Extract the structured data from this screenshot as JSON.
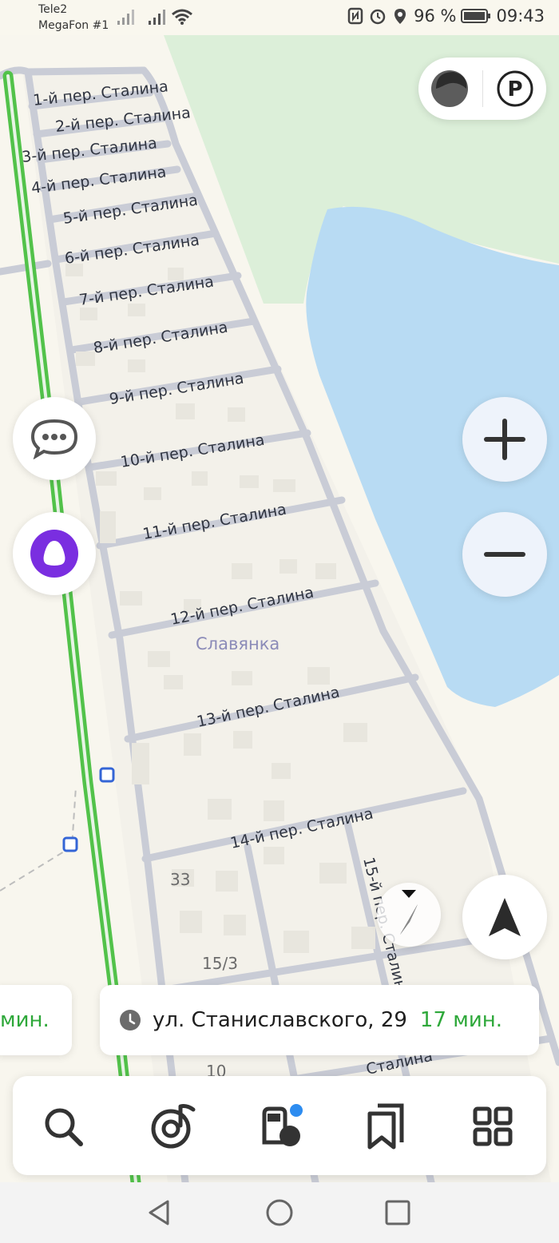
{
  "status_bar": {
    "carrier_1": "Tele2",
    "carrier_2": "MegaFon #1",
    "battery": "96 %",
    "time": "09:43"
  },
  "map": {
    "streets": [
      "1-й пер. Сталина",
      "2-й пер. Сталина",
      "3-й пер. Сталина",
      "4-й пер. Сталина",
      "5-й пер. Сталина",
      "6-й пер. Сталина",
      "7-й пер. Сталина",
      "8-й пер. Сталина",
      "9-й пер. Сталина",
      "10-й пер. Сталина",
      "11-й пер. Сталина",
      "12-й пер. Сталина",
      "13-й пер. Сталина",
      "14-й пер. Сталина",
      "15-й пер. Сталина",
      "Сталина"
    ],
    "locality": "Славянка",
    "house_numbers": [
      "33",
      "15/3",
      "10"
    ]
  },
  "controls": {
    "layers_icon": "traffic-layer-icon",
    "parking_label": "P",
    "chat_icon": "chat-icon",
    "alice_icon": "alice-voice-icon",
    "zoom_in_icon": "plus-icon",
    "zoom_out_icon": "minus-icon",
    "compass_icon": "compass-icon",
    "navigate_icon": "navigation-arrow-icon"
  },
  "route_chips": {
    "left_time": "мин.",
    "main_address": "ул. Станиславского, 29",
    "main_time": "17 мин."
  },
  "toolbar": {
    "items": [
      "search-icon",
      "music-icon",
      "gas-station-icon",
      "bookmarks-icon",
      "services-grid-icon"
    ]
  },
  "system_nav": [
    "back-icon",
    "home-icon",
    "recents-icon"
  ],
  "colors": {
    "map_background": "#f8f6ee",
    "forest": "#dcefd9",
    "water": "#b8dbf3",
    "road": "#c9ccd6",
    "highway_green": "#52c24a",
    "accent_green": "#2ea83a",
    "alice_purple": "#7a2ee0"
  }
}
